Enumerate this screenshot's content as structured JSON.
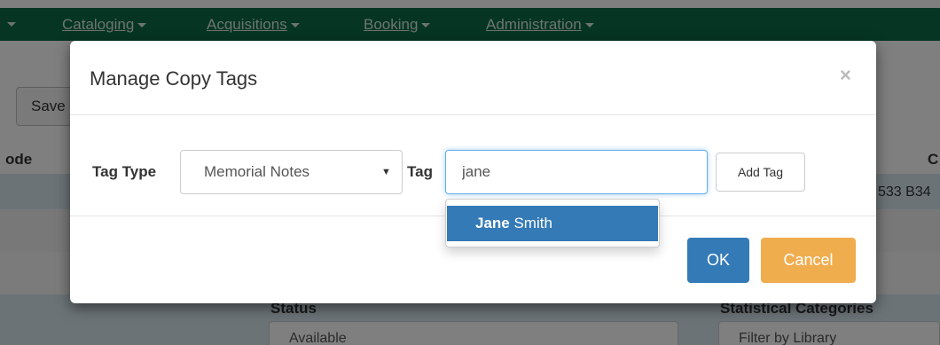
{
  "navbar": {
    "items": [
      {
        "label": "Cataloging"
      },
      {
        "label": "Acquisitions"
      },
      {
        "label": "Booking"
      },
      {
        "label": "Administration"
      }
    ],
    "color": "#0c6a46"
  },
  "background": {
    "save_button_label": "Save",
    "left_column_header": "ode",
    "right_column_header": "C",
    "right_cell_text": "533 B34",
    "status_label": "Status",
    "status_value": "Available",
    "stat_categories_label": "Statistical Categories",
    "stat_filter_placeholder": "Filter by Library"
  },
  "modal": {
    "title": "Manage Copy Tags",
    "close_glyph": "×",
    "tag_type_label": "Tag Type",
    "tag_type_value": "Memorial Notes",
    "tag_label": "Tag",
    "tag_input_value": "jane",
    "add_tag_label": "Add Tag",
    "ok_label": "OK",
    "cancel_label": "Cancel",
    "colors": {
      "primary": "#337ab7",
      "warning": "#f0ad4e"
    }
  },
  "typeahead": {
    "suggestions": [
      {
        "match": "Jane",
        "rest": " Smith"
      }
    ]
  }
}
